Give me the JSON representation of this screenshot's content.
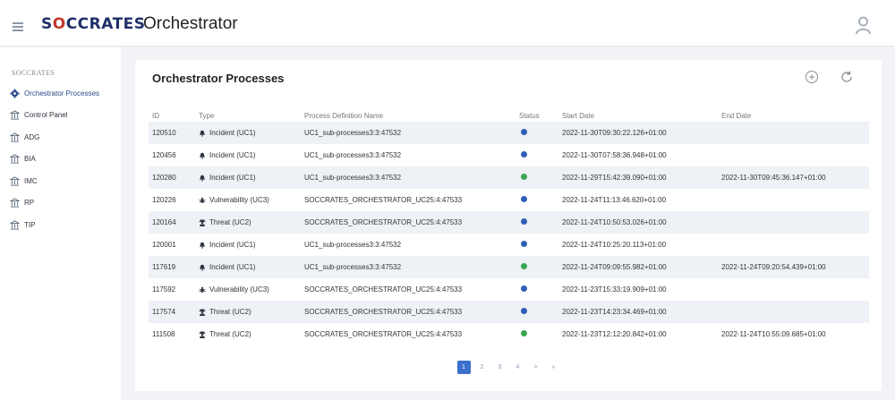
{
  "header": {
    "logo_prefix": "S",
    "logo_o": "O",
    "logo_suffix": "CCRATES",
    "app_title": "Orchestrator"
  },
  "sidebar": {
    "section": "SOCCRATES",
    "items": [
      {
        "label": "Orchestrator Processes",
        "icon": "gear-icon",
        "active": true
      },
      {
        "label": "Control Panel",
        "icon": "bank-icon"
      },
      {
        "label": "ADG",
        "icon": "bank-icon"
      },
      {
        "label": "BIA",
        "icon": "bank-icon"
      },
      {
        "label": "IMC",
        "icon": "bank-icon"
      },
      {
        "label": "RP",
        "icon": "bank-icon"
      },
      {
        "label": "TIP",
        "icon": "bank-icon"
      }
    ]
  },
  "main": {
    "title": "Orchestrator Processes",
    "columns": [
      "ID",
      "Type",
      "Process Definition Name",
      "Status",
      "Start Date",
      "End Date"
    ],
    "rows": [
      {
        "id": "120510",
        "type": "Incident (UC1)",
        "type_icon": "bell-icon",
        "process": "UC1_sub-processes3:3:47532",
        "status": "active",
        "start": "2022-11-30T09:30:22.126+01:00",
        "end": ""
      },
      {
        "id": "120456",
        "type": "Incident (UC1)",
        "type_icon": "bell-icon",
        "process": "UC1_sub-processes3:3:47532",
        "status": "active",
        "start": "2022-11-30T07:58:36.948+01:00",
        "end": ""
      },
      {
        "id": "120280",
        "type": "Incident (UC1)",
        "type_icon": "bell-icon",
        "process": "UC1_sub-processes3:3:47532",
        "status": "completed",
        "start": "2022-11-29T15:42:39.090+01:00",
        "end": "2022-11-30T09:45:36.147+01:00"
      },
      {
        "id": "120226",
        "type": "Vulnerability (UC3)",
        "type_icon": "bug-icon",
        "process": "SOCCRATES_ORCHESTRATOR_UC25:4:47533",
        "status": "active",
        "start": "2022-11-24T11:13:46.620+01:00",
        "end": ""
      },
      {
        "id": "120164",
        "type": "Threat (UC2)",
        "type_icon": "user-secret-icon",
        "process": "SOCCRATES_ORCHESTRATOR_UC25:4:47533",
        "status": "active",
        "start": "2022-11-24T10:50:53.026+01:00",
        "end": ""
      },
      {
        "id": "120001",
        "type": "Incident (UC1)",
        "type_icon": "bell-icon",
        "process": "UC1_sub-processes3:3:47532",
        "status": "active",
        "start": "2022-11-24T10:25:20.113+01:00",
        "end": ""
      },
      {
        "id": "117619",
        "type": "Incident (UC1)",
        "type_icon": "bell-icon",
        "process": "UC1_sub-processes3:3:47532",
        "status": "completed",
        "start": "2022-11-24T09:09:55.982+01:00",
        "end": "2022-11-24T09:20:54.439+01:00"
      },
      {
        "id": "117592",
        "type": "Vulnerability (UC3)",
        "type_icon": "bug-icon",
        "process": "SOCCRATES_ORCHESTRATOR_UC25:4:47533",
        "status": "active",
        "start": "2022-11-23T15:33:19.909+01:00",
        "end": ""
      },
      {
        "id": "117574",
        "type": "Threat (UC2)",
        "type_icon": "user-secret-icon",
        "process": "SOCCRATES_ORCHESTRATOR_UC25:4:47533",
        "status": "active",
        "start": "2022-11-23T14:23:34.469+01:00",
        "end": ""
      },
      {
        "id": "111508",
        "type": "Threat (UC2)",
        "type_icon": "user-secret-icon",
        "process": "SOCCRATES_ORCHESTRATOR_UC25:4:47533",
        "status": "completed",
        "start": "2022-11-23T12:12:20.842+01:00",
        "end": "2022-11-24T10:55:09.685+01:00"
      }
    ],
    "status_colors": {
      "active": "#2d5fb8",
      "completed": "#3aa651"
    },
    "pagination": {
      "pages": [
        "1",
        "2",
        "3",
        "4"
      ],
      "current": "1",
      "next": ">",
      "last": "»"
    }
  }
}
